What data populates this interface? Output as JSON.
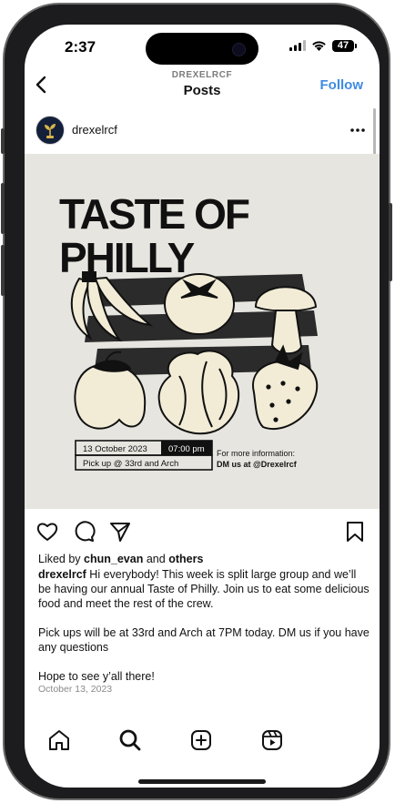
{
  "status_bar": {
    "time": "2:37",
    "battery": "47"
  },
  "nav": {
    "account": "DREXELRCF",
    "title": "Posts",
    "follow_label": "Follow"
  },
  "post": {
    "username": "drexelrcf",
    "poster": {
      "headline_line1": "TASTE OF",
      "headline_line2": "PHILLY",
      "event_date": "13 October 2023",
      "event_time": "07:00 pm",
      "pickup": "Pick up @ 33rd and Arch",
      "info_line1": "For more information:",
      "info_line2": "DM us at @Drexelrcf"
    },
    "liked_by_prefix": "Liked by",
    "liked_by_user": "chun_evan",
    "liked_by_and": "and",
    "liked_by_others": "others",
    "caption_user": "drexelrcf",
    "caption_p1": "Hi everybody! This week is split large group and we’ll be having our annual Taste of Philly. Join us to eat some delicious food and meet the rest of the crew.",
    "caption_p2": "Pick ups will be at 33rd and Arch at 7PM today. DM us if you have any questions",
    "caption_p3": "Hope to see y’all there!",
    "date": "October 13, 2023"
  },
  "icons": {
    "back": "chevron-left-icon",
    "more": "more-dots-icon",
    "like": "heart-icon",
    "comment": "comment-icon",
    "share": "paper-plane-icon",
    "save": "bookmark-icon",
    "home": "home-icon",
    "search": "search-icon",
    "create": "plus-square-icon",
    "reels": "reels-icon"
  },
  "colors": {
    "accent": "#3f8be0",
    "poster_bg": "#e6e5df",
    "poster_ink": "#111111",
    "food_cream": "#f2ecd6"
  }
}
